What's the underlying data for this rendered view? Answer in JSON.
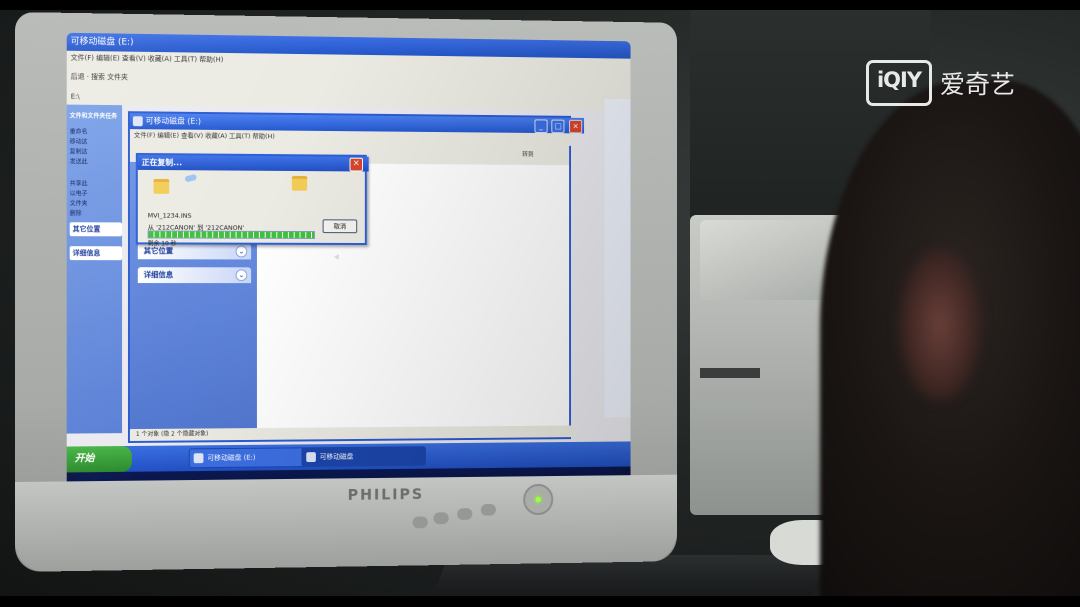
{
  "watermark": {
    "logo_text": "iQIY",
    "brand_text": "爱奇艺"
  },
  "monitor": {
    "brand": "PHILIPS"
  },
  "explorer_back": {
    "title": "可移动磁盘 (E:)",
    "menu": "文件(F)  编辑(E)  查看(V)  收藏(A)  工具(T)  帮助(H)",
    "toolbar": "后退  ·  搜索  文件夹",
    "address": "E:\\",
    "left_header": "文件和文件夹任务",
    "left_items": [
      "重命名",
      "移动这",
      "复制这",
      "发送此",
      "共享此",
      "以电子",
      "文件夹",
      "删除"
    ],
    "other_places": "其它位置",
    "details": "详细信息",
    "status": "1 个对象"
  },
  "explorer_front": {
    "title": "可移动磁盘 (E:)",
    "menu": "文件(F)  编辑(E)  查看(V)  收藏(A)  工具(T)  帮助(H)",
    "address_go": "转到",
    "other_places": "其它位置",
    "details": "详细信息",
    "status": "1 个对象 (隐 2 个隐藏对象)"
  },
  "copy_dialog": {
    "title": "正在复制...",
    "file_name": "MVI_1234.INS",
    "from_to": "从 '212CANON' 到 '212CANON'",
    "remaining": "剩余 10 秒",
    "progress": 1.0,
    "cancel_label": "取消",
    "close_glyph": "×"
  },
  "taskbar": {
    "start_label": "开始",
    "items": [
      "可移动磁盘 (E:)",
      "可移动磁盘"
    ]
  }
}
